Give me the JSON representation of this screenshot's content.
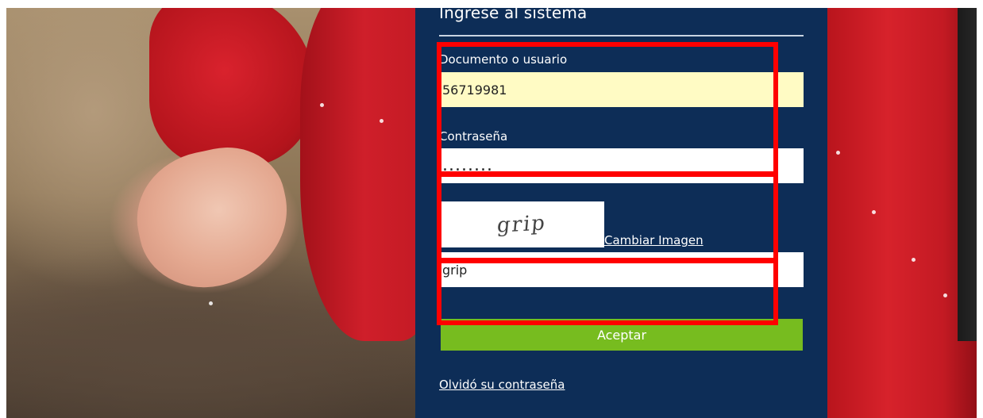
{
  "login": {
    "title": "Ingrese al sistema",
    "user_label": "Documento o usuario",
    "user_value": "56719981",
    "password_label": "Contraseña",
    "password_value": "........",
    "captcha_image_text": "grip",
    "change_image_link": "Cambiar Imagen",
    "captcha_value": "grip",
    "accept_button": "Aceptar",
    "forgot_password_link": "Olvidó su contraseña"
  },
  "colors": {
    "panel_bg": "#0d2d57",
    "user_field_bg": "#fffbc4",
    "accept_button_bg": "#77bc1f",
    "annotation_box": "#ff0000"
  }
}
